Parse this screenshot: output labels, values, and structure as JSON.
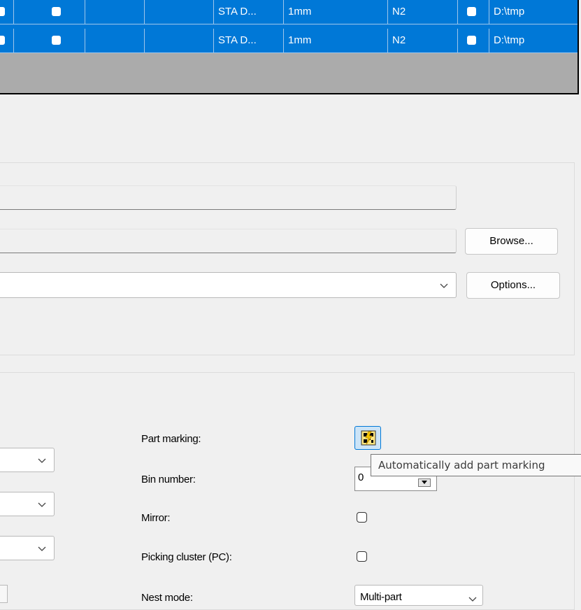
{
  "grid": {
    "rows": [
      {
        "program": "STA D...",
        "thickness": "1mm",
        "gas": "N2",
        "path": "D:\\tmp"
      },
      {
        "program": "STA D...",
        "thickness": "1mm",
        "gas": "N2",
        "path": "D:\\tmp"
      }
    ]
  },
  "output": {
    "browse_label": "Browse...",
    "options_label": "Options..."
  },
  "settings": {
    "part_marking_label": "Part marking:",
    "bin_number_label": "Bin number:",
    "bin_number_value": "0",
    "mirror_label": "Mirror:",
    "picking_cluster_label": "Picking cluster (PC):",
    "nest_mode_label": "Nest mode:",
    "nest_mode_value": "Multi-part"
  },
  "tooltip": {
    "text": "Automatically add part marking"
  },
  "icons": {
    "part_marking": "auto-part-marking-icon",
    "dropdown": "chevron-down-icon"
  },
  "colors": {
    "selection": "#0078d7",
    "window_bg": "#f0f0f0"
  }
}
